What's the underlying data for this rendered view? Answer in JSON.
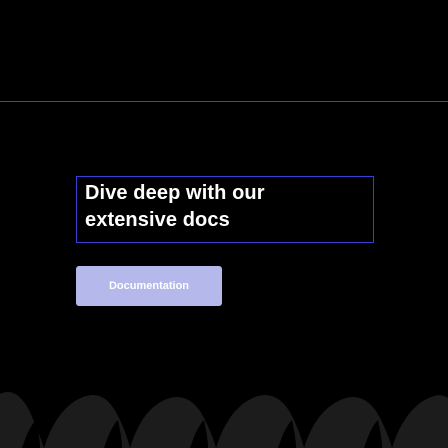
{
  "headline": {
    "line1": "Dive deep with our",
    "line2": "extensive docs"
  },
  "cta": {
    "label": "Documentation"
  },
  "colors": {
    "background": "#000000",
    "accent": "#3b3fd9",
    "button": "#b4b8eb",
    "text": "#ffffff",
    "wave": "#1c1c1c"
  }
}
